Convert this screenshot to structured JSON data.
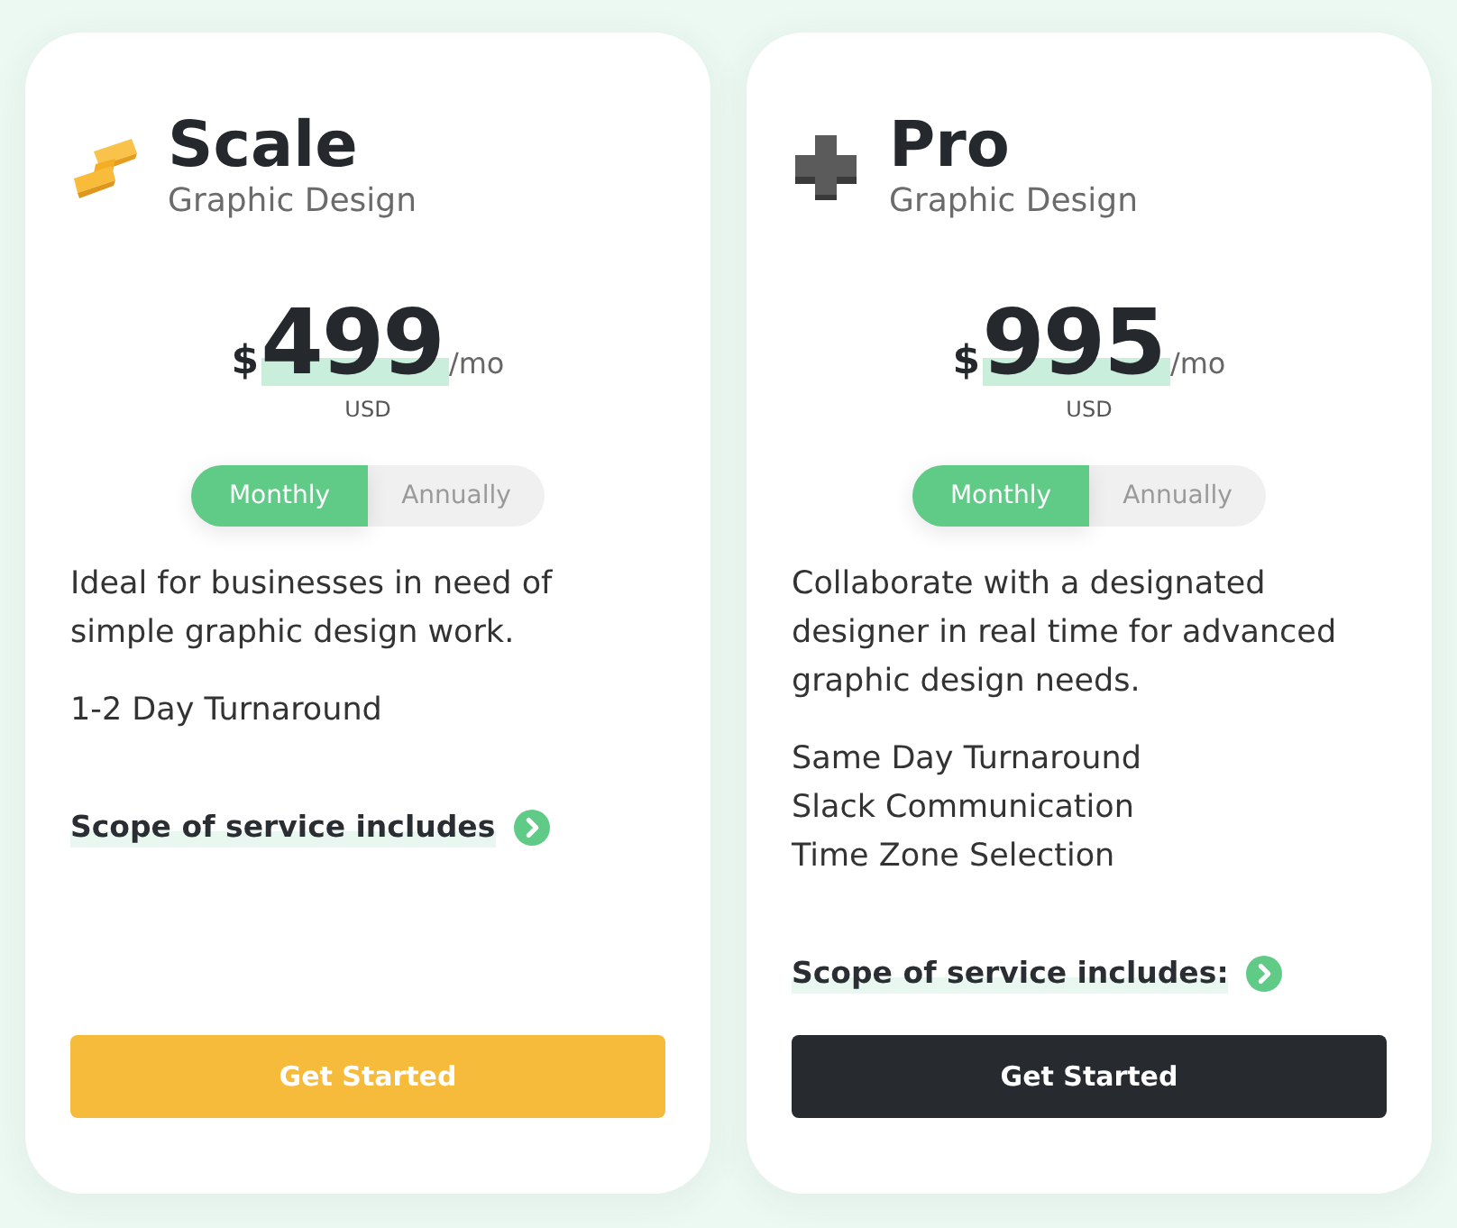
{
  "plans": [
    {
      "kind": "zigzag",
      "name": "Scale",
      "subtitle": "Graphic Design",
      "price": {
        "currency_symbol": "$",
        "amount": "499",
        "period": "/mo",
        "currency": "USD"
      },
      "billing_options": [
        {
          "label": "Monthly",
          "selected": true
        },
        {
          "label": "Annually",
          "selected": false
        }
      ],
      "description": "Ideal for businesses in need of simple graphic design work.",
      "features": [
        "1-2 Day Turnaround"
      ],
      "scope_link": "Scope of service includes",
      "button": {
        "label": "Get Started",
        "color": "#f6bb3a"
      }
    },
    {
      "kind": "cross",
      "name": "Pro",
      "subtitle": "Graphic Design",
      "price": {
        "currency_symbol": "$",
        "amount": "995",
        "period": "/mo",
        "currency": "USD"
      },
      "billing_options": [
        {
          "label": "Monthly",
          "selected": true
        },
        {
          "label": "Annually",
          "selected": false
        }
      ],
      "description": "Collaborate with a designated designer in real time for advanced graphic design needs.",
      "features": [
        "Same Day Turnaround",
        "Slack Communication",
        "Time Zone Selection"
      ],
      "scope_link": "Scope of service includes:",
      "button": {
        "label": "Get Started",
        "color": "#272a2f"
      }
    }
  ]
}
